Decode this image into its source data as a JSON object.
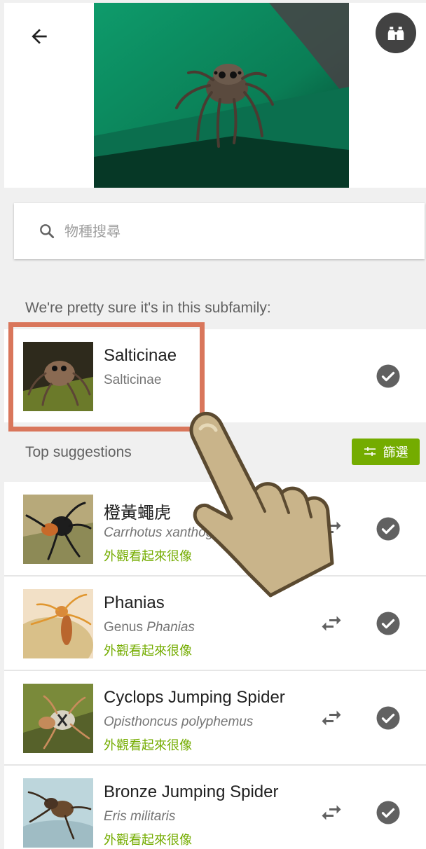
{
  "header": {
    "back_label": "back",
    "binoculars_label": "explore"
  },
  "search": {
    "placeholder": "物種搜尋"
  },
  "subfamily_section": {
    "heading": "We're pretty sure it's in this subfamily:",
    "result": {
      "title": "Salticinae",
      "subtitle": "Salticinae"
    }
  },
  "suggestions_section": {
    "heading": "Top suggestions",
    "filter_label": "篩選",
    "items": [
      {
        "title": "橙黃蠅虎",
        "sub_prefix": "",
        "sub_italic": "Carrhotus xanthogramma",
        "hint": "外觀看起來很像"
      },
      {
        "title": "Phanias",
        "sub_prefix": "Genus ",
        "sub_italic": "Phanias",
        "hint": "外觀看起來很像"
      },
      {
        "title": "Cyclops Jumping Spider",
        "sub_prefix": "",
        "sub_italic": "Opisthoncus polyphemus",
        "hint": "外觀看起來很像"
      },
      {
        "title": "Bronze Jumping Spider",
        "sub_prefix": "",
        "sub_italic": "Eris militaris",
        "hint": "外觀看起來很像"
      }
    ]
  },
  "colors": {
    "accent_green": "#74ac00",
    "highlight": "#d9765b",
    "dark_button": "#424242",
    "check_gray": "#616161"
  },
  "icons": {
    "back": "arrow-left-icon",
    "binoculars": "binoculars-icon",
    "search": "search-icon",
    "filter": "sliders-icon",
    "compare": "swap-arrows-icon",
    "check": "check-circle-icon"
  }
}
